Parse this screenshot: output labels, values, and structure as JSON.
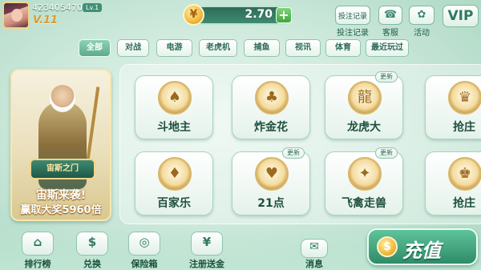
{
  "user": {
    "id": "423405470",
    "level": "Lv.1",
    "vip": "V.11"
  },
  "wallet": {
    "balance": "2.70",
    "coin_symbol": "¥",
    "add_symbol": "+"
  },
  "top_actions": [
    {
      "label": "投注记录",
      "icon": "document-icon"
    },
    {
      "label": "客服",
      "icon": "headset-icon"
    },
    {
      "label": "活动",
      "icon": "gift-icon"
    }
  ],
  "vip_button": "VIP",
  "categories": [
    "全部",
    "对战",
    "电游",
    "老虎机",
    "捕鱼",
    "视讯",
    "体育",
    "最近玩过"
  ],
  "promo": {
    "logo_text": "宙斯之门",
    "line1": "宙斯来袭!",
    "line2": "赢取大奖5960倍"
  },
  "games": [
    {
      "label": "斗地主",
      "icon": "♠",
      "new": ""
    },
    {
      "label": "炸金花",
      "icon": "♣",
      "new": ""
    },
    {
      "label": "龙虎大",
      "icon": "龍",
      "new": "更新"
    },
    {
      "label": "抢庄",
      "icon": "♛",
      "new": ""
    },
    {
      "label": "百家乐",
      "icon": "♦",
      "new": ""
    },
    {
      "label": "21点",
      "icon": "♥",
      "new": "更新"
    },
    {
      "label": "飞禽走兽",
      "icon": "✦",
      "new": "更新"
    },
    {
      "label": "抢庄",
      "icon": "♚",
      "new": ""
    }
  ],
  "bottom_nav": [
    {
      "label": "排行榜",
      "icon": "⌂"
    },
    {
      "label": "兑换",
      "icon": "$"
    },
    {
      "label": "保险箱",
      "icon": "◎"
    },
    {
      "label": "注册送金",
      "icon": "¥"
    },
    {
      "label": "消息",
      "icon": "✉"
    }
  ],
  "recharge": {
    "label": "充值",
    "icon": "$"
  }
}
